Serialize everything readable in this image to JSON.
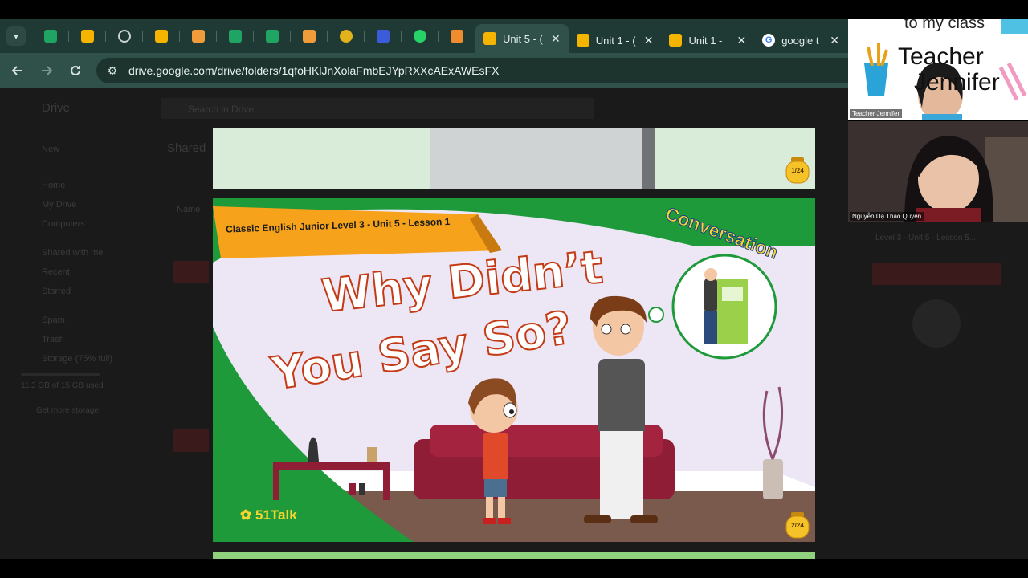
{
  "browser": {
    "pinned_tabs": [
      {
        "icon": "sheets-icon",
        "color": "#1fa463"
      },
      {
        "icon": "drive-icon",
        "color": "#f4b400"
      },
      {
        "icon": "globe-icon",
        "color": "#c9d4d1"
      },
      {
        "icon": "drive-icon",
        "color": "#f4b400"
      },
      {
        "icon": "folder-icon",
        "color": "#f09c3a"
      },
      {
        "icon": "sheets-icon",
        "color": "#1fa463"
      },
      {
        "icon": "sheets-icon",
        "color": "#1fa463"
      },
      {
        "icon": "folder-icon",
        "color": "#f09c3a"
      },
      {
        "icon": "coin-icon",
        "color": "#e2b21c"
      },
      {
        "icon": "app-icon",
        "color": "#3b5bdb"
      },
      {
        "icon": "whatsapp-icon",
        "color": "#25d366"
      },
      {
        "icon": "fox-icon",
        "color": "#f08c2e"
      }
    ],
    "tabs": [
      {
        "label": "Unit 5 - (",
        "icon": "drive-icon",
        "active": true
      },
      {
        "label": "Unit 1 - (",
        "icon": "drive-icon",
        "active": false
      },
      {
        "label": "Unit 1 - ",
        "icon": "drive-icon",
        "active": false
      },
      {
        "label": "google t",
        "icon": "google-icon",
        "active": false
      }
    ],
    "url": "drive.google.com/drive/folders/1qfoHKlJnXolaFmbEJYpRXXcAExAWEsFX"
  },
  "drive": {
    "app_name": "Drive",
    "search_placeholder": "Search in Drive",
    "new_label": "New",
    "nav": [
      "Home",
      "My Drive",
      "Computers",
      "Shared with me",
      "Recent",
      "Starred",
      "Spam",
      "Trash",
      "Storage (75% full)"
    ],
    "storage_text": "11.3 GB of 15 GB used",
    "storage_button": "Get more storage",
    "heading": "Shared",
    "name_header": "Name",
    "right_file": "Level 3 - Unit 5 - Lesson 5..."
  },
  "slides": {
    "slide1_page": "1/24",
    "slide2_page": "2/24",
    "banner": "Classic English Junior Level 3 - Unit 5 - Lesson 1",
    "tag": "Conversation",
    "title_line1": "Why Didn’t",
    "title_line2": "You Say So?",
    "logo": "51Talk"
  },
  "video": {
    "teacher_sign_top": "to my class",
    "teacher_sign_line1": "Teacher",
    "teacher_sign_line2": "Jennifer",
    "teacher_name": "Teacher Jennifer",
    "student_name": "Nguyễn Dạ Thảo Quyên"
  }
}
